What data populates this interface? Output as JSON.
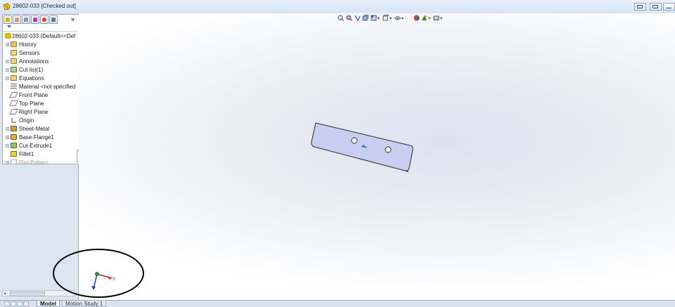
{
  "window": {
    "title": "28602-033 [Checked out]",
    "controls": [
      "restore-icon",
      "maximize-icon",
      "minimize-icon"
    ]
  },
  "feature_manager": {
    "tabs": [
      "feature-manager-icon",
      "property-manager-icon",
      "configuration-manager-icon",
      "dimxpert-icon",
      "display-manager-icon",
      "cam-icon"
    ],
    "more_label": "»",
    "root": "28602-033  (Default<<Def",
    "items": [
      {
        "label": "History",
        "icon": "history-icon",
        "expandable": true
      },
      {
        "label": "Sensors",
        "icon": "sensors-icon",
        "expandable": false
      },
      {
        "label": "Annotations",
        "icon": "annotations-icon",
        "expandable": true
      },
      {
        "label": "Cut list(1)",
        "icon": "cut-list-icon",
        "expandable": true
      },
      {
        "label": "Equations",
        "icon": "equations-icon",
        "expandable": true
      },
      {
        "label": "Material <not specified",
        "icon": "material-icon",
        "expandable": false
      },
      {
        "label": "Front Plane",
        "icon": "plane-icon",
        "expandable": false
      },
      {
        "label": "Top Plane",
        "icon": "plane-icon",
        "expandable": false
      },
      {
        "label": "Right Plane",
        "icon": "plane-icon",
        "expandable": false
      },
      {
        "label": "Origin",
        "icon": "origin-icon",
        "expandable": false
      },
      {
        "label": "Sheet-Metal",
        "icon": "sheet-metal-icon",
        "expandable": true
      },
      {
        "label": "Base-Flange1",
        "icon": "base-flange-icon",
        "expandable": true
      },
      {
        "label": "Cut-Extrude1",
        "icon": "cut-extrude-icon",
        "expandable": true
      },
      {
        "label": "Fillet1",
        "icon": "fillet-icon",
        "expandable": false
      },
      {
        "label": "Flat-Pattern",
        "icon": "flat-pattern-icon",
        "expandable": true,
        "suppressed": true
      }
    ]
  },
  "heads_up_toolbar": [
    "zoom-to-fit-icon",
    "zoom-to-area-icon",
    "previous-view-icon",
    "section-view-icon",
    "view-orientation-icon",
    "display-style-icon",
    "hide-show-items-icon",
    "edit-appearance-icon",
    "apply-scene-icon",
    "view-settings-icon"
  ],
  "bottom_tabs": {
    "model": "Model",
    "motion_study": "Motion Study 1"
  },
  "triad": {
    "x_label": "X"
  },
  "colors": {
    "part_face": "#c9cff0",
    "part_edge": "#2b2b2b",
    "triad_x": "#d02020",
    "triad_y": "#2aa02a",
    "triad_z": "#2040d0",
    "annotation_circle": "#000000"
  }
}
